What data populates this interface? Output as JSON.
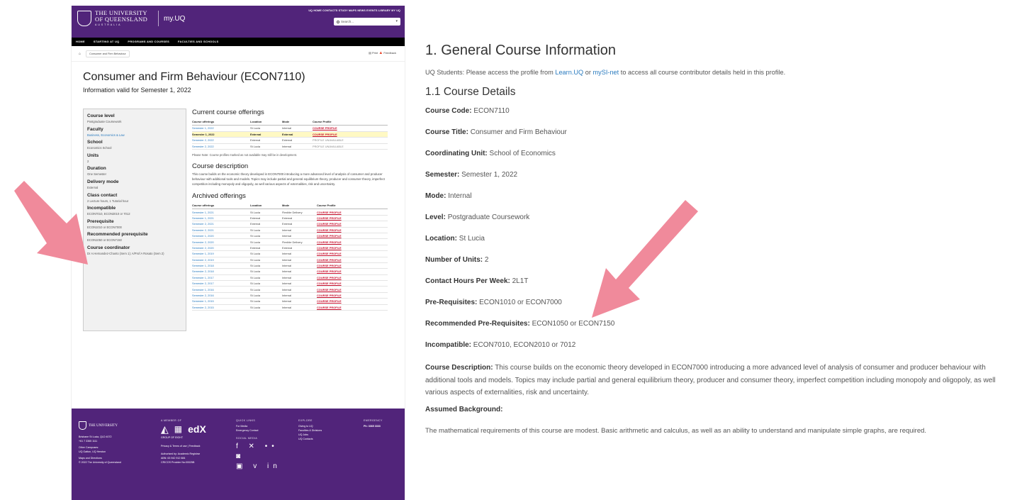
{
  "uq_page": {
    "logo_line1": "THE UNIVERSITY",
    "logo_line2": "OF QUEENSLAND",
    "logo_sub": "AUSTRALIA",
    "myuq": "my.UQ",
    "top_links": "UQ HOME   CONTACTS   STUDY   MAPS   NEWS   EVENTS   LIBRARY   MY UQ",
    "search_placeholder": "Search...",
    "nav": [
      "HOME",
      "STARTING AT UQ",
      "PROGRAMS AND COURSES",
      "FACULTIES AND SCHOOLS"
    ],
    "breadcrumb": "Consumer and Firm Behaviour",
    "print_label": "Print",
    "feedback_label": "Feedback",
    "course_title": "Consumer and Firm Behaviour (ECON7110)",
    "valid_for": "Information valid for Semester 1, 2022",
    "sidebar": [
      {
        "label": "Course level",
        "value": "Postgraduate Coursework"
      },
      {
        "label": "Faculty",
        "value": "Business, Economics & Law",
        "link": true
      },
      {
        "label": "School",
        "value": "Economics School"
      },
      {
        "label": "Units",
        "value": "2"
      },
      {
        "label": "Duration",
        "value": "One Semester"
      },
      {
        "label": "Delivery mode",
        "value": "External"
      },
      {
        "label": "Class contact",
        "value": "2 Lecture hours, 1 Tutorial hour"
      },
      {
        "label": "Incompatible",
        "value": "ECON7010, ECON2010 or 7012"
      },
      {
        "label": "Prerequisite",
        "value": "ECON1010 or ECON7000"
      },
      {
        "label": "Recommended prerequisite",
        "value": "ECON1050 or ECON7150"
      },
      {
        "label": "Course coordinator",
        "value": "Dr A.Hernandez-Chanto (Sem 1); A/Prof A Rosato (Sem 2)"
      }
    ],
    "current_heading": "Current course offerings",
    "table_headers": [
      "Course offerings",
      "Location",
      "Mode",
      "Course Profile"
    ],
    "current_offerings": [
      {
        "offering": "Semester 1, 2022",
        "location": "St Lucia",
        "mode": "Internal",
        "profile": "COURSE PROFILE",
        "status": "link"
      },
      {
        "offering": "Semester 1, 2022",
        "location": "External",
        "mode": "External",
        "profile": "COURSE PROFILE",
        "status": "highlight"
      },
      {
        "offering": "Semester 2, 2022",
        "location": "External",
        "mode": "External",
        "profile": "PROFILE UNAVAILABLE",
        "status": "na"
      },
      {
        "offering": "Semester 2, 2022",
        "location": "St Lucia",
        "mode": "Internal",
        "profile": "PROFILE UNAVAILABLE",
        "status": "na"
      }
    ],
    "note": "Please Note: Course profiles marked as not available may still be in development.",
    "description_heading": "Course description",
    "description": "This course builds on the economic theory developed in ECON7000 introducing a more advanced level of analysis of consumer and producer behaviour with additional tools and models. Topics may include partial and general equilibrium theory, producer and consumer theory, imperfect competition including monopoly and oligopoly, as well various aspects of externalities, risk and uncertainty.",
    "archived_heading": "Archived offerings",
    "archived_headers": [
      "Course offerings",
      "Location",
      "Mode",
      "Course Profile"
    ],
    "archived_offerings": [
      {
        "offering": "Semester 1, 2021",
        "location": "St Lucia",
        "mode": "Flexible Delivery",
        "profile": "COURSE PROFILE"
      },
      {
        "offering": "Semester 1, 2021",
        "location": "External",
        "mode": "External",
        "profile": "COURSE PROFILE"
      },
      {
        "offering": "Semester 2, 2021",
        "location": "External",
        "mode": "External",
        "profile": "COURSE PROFILE"
      },
      {
        "offering": "Semester 2, 2021",
        "location": "St Lucia",
        "mode": "Internal",
        "profile": "COURSE PROFILE"
      },
      {
        "offering": "Semester 1, 2020",
        "location": "St Lucia",
        "mode": "Internal",
        "profile": "COURSE PROFILE"
      },
      {
        "offering": "Semester 2, 2020",
        "location": "St Lucia",
        "mode": "Flexible Delivery",
        "profile": "COURSE PROFILE"
      },
      {
        "offering": "Semester 2, 2020",
        "location": "External",
        "mode": "External",
        "profile": "COURSE PROFILE"
      },
      {
        "offering": "Semester 1, 2019",
        "location": "St Lucia",
        "mode": "Internal",
        "profile": "COURSE PROFILE"
      },
      {
        "offering": "Semester 2, 2019",
        "location": "St Lucia",
        "mode": "Internal",
        "profile": "COURSE PROFILE"
      },
      {
        "offering": "Semester 1, 2018",
        "location": "St Lucia",
        "mode": "Internal",
        "profile": "COURSE PROFILE"
      },
      {
        "offering": "Semester 2, 2018",
        "location": "St Lucia",
        "mode": "Internal",
        "profile": "COURSE PROFILE"
      },
      {
        "offering": "Semester 1, 2017",
        "location": "St Lucia",
        "mode": "Internal",
        "profile": "COURSE PROFILE"
      },
      {
        "offering": "Semester 2, 2017",
        "location": "St Lucia",
        "mode": "Internal",
        "profile": "COURSE PROFILE"
      },
      {
        "offering": "Semester 1, 2016",
        "location": "St Lucia",
        "mode": "Internal",
        "profile": "COURSE PROFILE"
      },
      {
        "offering": "Semester 2, 2016",
        "location": "St Lucia",
        "mode": "Internal",
        "profile": "COURSE PROFILE"
      },
      {
        "offering": "Semester 1, 2015",
        "location": "St Lucia",
        "mode": "Internal",
        "profile": "COURSE PROFILE"
      },
      {
        "offering": "Semester 2, 2015",
        "location": "St Lucia",
        "mode": "Internal",
        "profile": "COURSE PROFILE"
      }
    ],
    "footer": {
      "address": "Brisbane St Lucia, QLD 4072",
      "phone": "+61 7 3365 1111",
      "campuses": "Other Campuses:",
      "campuses2": "UQ Gatton, UQ Herston",
      "maps": "Maps and Directions",
      "copyright": "© 2022 The University of Queensland",
      "member_heading": "A MEMBER OF",
      "group": "GROUP OF EIGHT",
      "edx": "edX",
      "privacy": "Privacy & Terms of use | Feedback",
      "authorised": "Authorised by: Academic Registrar",
      "abn": "ABN: 63 942 912 684",
      "cricos": "CRICOS Provider No:00025B",
      "quick_heading": "QUICK LINKS",
      "quick_links": [
        "For Media",
        "Emergency Contact"
      ],
      "social_heading": "SOCIAL MEDIA",
      "social_row1": "f  ✕  ••  ◙",
      "social_row2": "▣  v  in",
      "explore_heading": "EXPLORE",
      "explore_links": [
        "Giving to UQ",
        "Faculties & Divisions",
        "UQ Jobs",
        "UQ Contacts"
      ],
      "emergency_heading": "EMERGENCY",
      "emergency_phone": "Ph: 3365 3333"
    }
  },
  "profile": {
    "h1": "1. General Course Information",
    "intro_pre": "UQ Students: Please access the profile from ",
    "intro_link1": "Learn.UQ",
    "intro_mid": " or ",
    "intro_link2": "mySI-net",
    "intro_post": " to access all course contributor details held in this profile.",
    "h2": "1.1 Course Details",
    "rows": [
      {
        "label": "Course Code:",
        "value": "ECON7110"
      },
      {
        "label": "Course Title:",
        "value": "Consumer and Firm Behaviour"
      },
      {
        "label": "Coordinating Unit:",
        "value": "School of Economics"
      },
      {
        "label": "Semester:",
        "value": "Semester 1, 2022"
      },
      {
        "label": "Mode:",
        "value": "Internal"
      },
      {
        "label": "Level:",
        "value": "Postgraduate Coursework"
      },
      {
        "label": "Location:",
        "value": "St Lucia"
      },
      {
        "label": "Number of Units:",
        "value": "2"
      },
      {
        "label": "Contact Hours Per Week:",
        "value": "2L1T"
      },
      {
        "label": "Pre-Requisites:",
        "value": "ECON1010 or ECON7000"
      },
      {
        "label": "Recommended Pre-Requisites:",
        "value": "ECON1050 or ECON7150"
      },
      {
        "label": "Incompatible:",
        "value": "ECON7010, ECON2010 or 7012"
      }
    ],
    "desc_label": "Course Description:",
    "desc_value": "This course builds on the economic theory developed in ECON7000 introducing a more advanced level of analysis of consumer and producer behaviour with additional tools and models. Topics may include partial and general equilibrium theory, producer and consumer theory, imperfect competition including monopoly and oligopoly, as well various aspects of externalities, risk and uncertainty.",
    "assumed_label": "Assumed Background:",
    "assumed_text": "The mathematical requirements of this course are modest. Basic arithmetic and calculus, as well as an ability to understand and manipulate simple graphs, are required."
  },
  "colors": {
    "uq_purple": "#51247a",
    "arrow_pink": "#f08a9b",
    "link_blue": "#2a7bbf"
  }
}
